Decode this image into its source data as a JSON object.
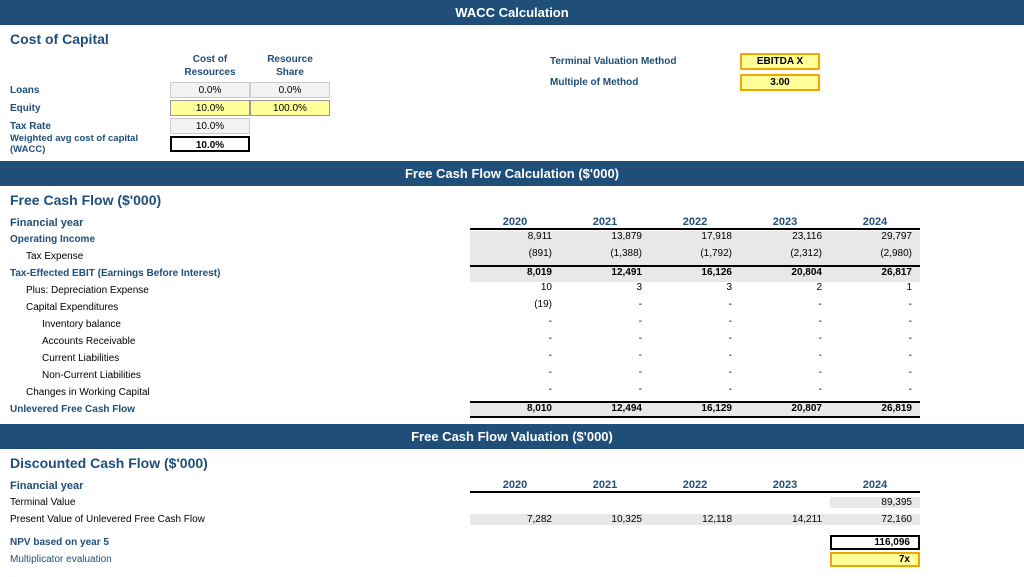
{
  "wacc_header": "WACC Calculation",
  "cost_of_capital_title": "Cost of Capital",
  "col_headers": [
    "Cost of Resources",
    "Resource Share"
  ],
  "wacc_rows": [
    {
      "label": "Loans",
      "cost": "0.0%",
      "share": "0.0%"
    },
    {
      "label": "Equity",
      "cost": "10.0%",
      "share": "100.0%"
    },
    {
      "label": "Tax Rate",
      "cost": "10.0%",
      "share": ""
    },
    {
      "label": "Weighted avg cost of capital (WACC)",
      "cost": "10.0%",
      "share": ""
    }
  ],
  "terminal_method_label": "Terminal Valuation Method",
  "terminal_method_value": "EBITDA X",
  "multiple_method_label": "Multiple of Method",
  "multiple_method_value": "3.00",
  "fcf_header": "Free Cash Flow Calculation ($'000)",
  "fcf_title": "Free Cash Flow ($'000)",
  "fcf_year_label": "Financial year",
  "years": [
    "2020",
    "2021",
    "2022",
    "2023",
    "2024"
  ],
  "fcf_rows": [
    {
      "label": "Operating Income",
      "type": "bold",
      "values": [
        "8,911",
        "13,879",
        "17,918",
        "23,116",
        "29,797"
      ]
    },
    {
      "label": "Tax Expense",
      "type": "indent1",
      "values": [
        "(891)",
        "(1,388)",
        "(1,792)",
        "(2,312)",
        "(2,980)"
      ]
    },
    {
      "label": "Tax-Effected EBIT (Earnings Before Interest)",
      "type": "bold",
      "values": [
        "8,019",
        "12,491",
        "16,126",
        "20,804",
        "26,817"
      ]
    },
    {
      "label": "Plus: Depreciation Expense",
      "type": "indent1",
      "values": [
        "10",
        "3",
        "3",
        "2",
        "1"
      ]
    },
    {
      "label": "Capital Expenditures",
      "type": "indent1",
      "values": [
        "(19)",
        "-",
        "-",
        "-",
        "-"
      ]
    },
    {
      "label": "Inventory balance",
      "type": "indent2",
      "values": [
        "-",
        "-",
        "-",
        "-",
        "-"
      ]
    },
    {
      "label": "Accounts Receivable",
      "type": "indent2",
      "values": [
        "-",
        "-",
        "-",
        "-",
        "-"
      ]
    },
    {
      "label": "Current Liabilities",
      "type": "indent2",
      "values": [
        "-",
        "-",
        "-",
        "-",
        "-"
      ]
    },
    {
      "label": "Non-Current Liabilities",
      "type": "indent2",
      "values": [
        "-",
        "-",
        "-",
        "-",
        "-"
      ]
    },
    {
      "label": "Changes in Working Capital",
      "type": "indent1",
      "values": [
        "-",
        "-",
        "-",
        "-",
        "-"
      ]
    },
    {
      "label": "Unlevered Free Cash Flow",
      "type": "bold_border",
      "values": [
        "8,010",
        "12,494",
        "16,129",
        "20,807",
        "26,819"
      ]
    }
  ],
  "valuation_header": "Free Cash Flow Valuation ($'000)",
  "dcf_title": "Discounted Cash Flow ($'000)",
  "dcf_year_label": "Financial year",
  "dcf_rows": [
    {
      "label": "Terminal Value",
      "type": "normal",
      "values": [
        "",
        "",
        "",
        "",
        "89,395"
      ]
    },
    {
      "label": "Present Value of Unlevered Free Cash Flow",
      "type": "normal",
      "values": [
        "7,282",
        "10,325",
        "12,118",
        "14,211",
        "72,160"
      ]
    }
  ],
  "npv_label": "NPV based on year 5",
  "npv_value": "116,096",
  "multiplicator_label": "Multiplicator evaluation",
  "multiplicator_value": "7x"
}
